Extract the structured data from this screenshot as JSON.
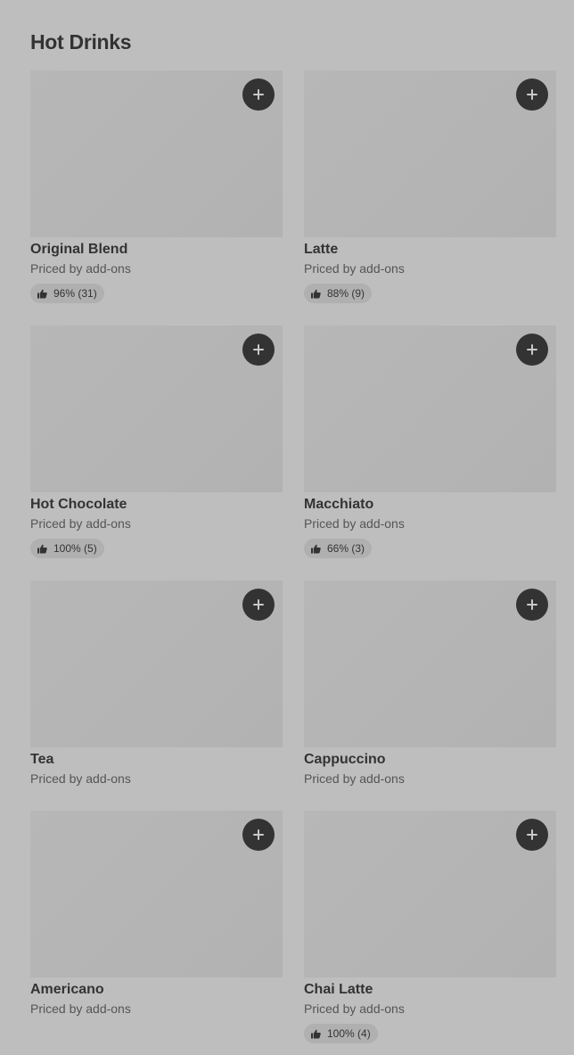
{
  "section": {
    "title": "Hot Drinks"
  },
  "items": [
    {
      "name": "Original Blend",
      "price": "Priced by add-ons",
      "rating": "96% (31)"
    },
    {
      "name": "Latte",
      "price": "Priced by add-ons",
      "rating": "88% (9)"
    },
    {
      "name": "Hot Chocolate",
      "price": "Priced by add-ons",
      "rating": "100% (5)"
    },
    {
      "name": "Macchiato",
      "price": "Priced by add-ons",
      "rating": "66% (3)"
    },
    {
      "name": "Tea",
      "price": "Priced by add-ons",
      "rating": null
    },
    {
      "name": "Cappuccino",
      "price": "Priced by add-ons",
      "rating": null
    },
    {
      "name": "Americano",
      "price": "Priced by add-ons",
      "rating": null
    },
    {
      "name": "Chai Latte",
      "price": "Priced by add-ons",
      "rating": "100% (4)"
    }
  ],
  "icons": {
    "add": "plus-icon",
    "rating": "thumbs-up-icon"
  },
  "colors": {
    "background": "#bebebe",
    "placeholder": "#b4b4b4",
    "add_button": "#333333",
    "text": "#333333"
  }
}
